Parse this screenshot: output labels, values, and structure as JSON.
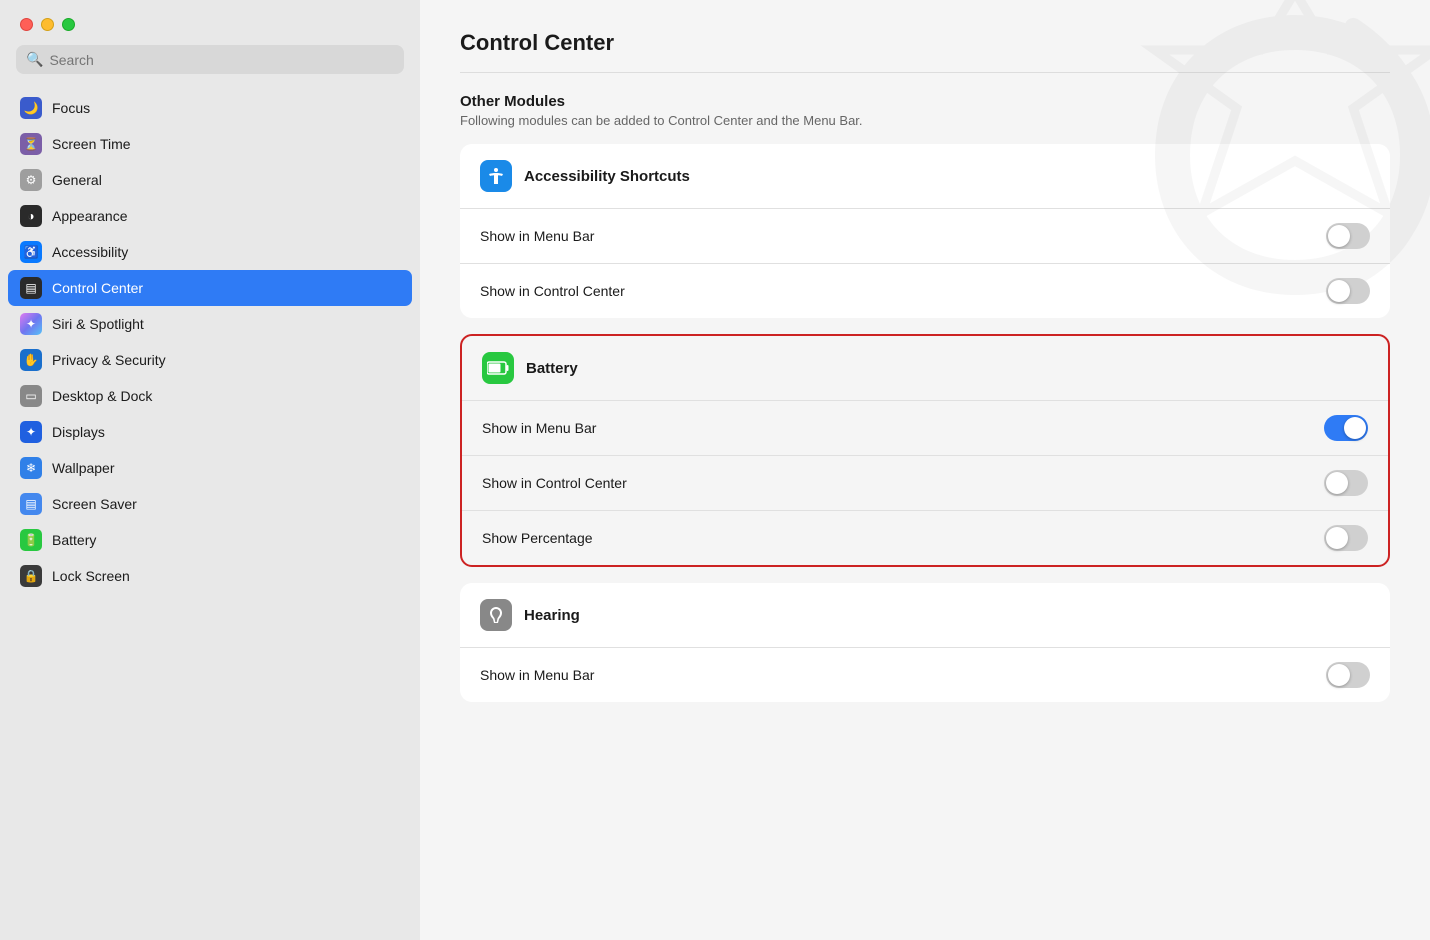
{
  "window": {
    "title": "Control Center"
  },
  "search": {
    "placeholder": "Search"
  },
  "sidebar": {
    "items": [
      {
        "id": "focus",
        "label": "Focus",
        "icon": "focus-blue",
        "emoji": "🌙"
      },
      {
        "id": "screen-time",
        "label": "Screen Time",
        "icon": "screen-time-purple",
        "emoji": "⏳"
      },
      {
        "id": "general",
        "label": "General",
        "icon": "general-gray",
        "emoji": "⚙"
      },
      {
        "id": "appearance",
        "label": "Appearance",
        "icon": "appearance-dark",
        "emoji": "◑"
      },
      {
        "id": "accessibility",
        "label": "Accessibility",
        "icon": "accessibility-blue",
        "emoji": "♿"
      },
      {
        "id": "control-center",
        "label": "Control Center",
        "icon": "control-center-dark",
        "emoji": "▤",
        "active": true
      },
      {
        "id": "siri-spotlight",
        "label": "Siri & Spotlight",
        "icon": "siri-gradient",
        "emoji": "✦"
      },
      {
        "id": "privacy-security",
        "label": "Privacy & Security",
        "icon": "privacy-blue",
        "emoji": "✋"
      },
      {
        "id": "desktop-dock",
        "label": "Desktop & Dock",
        "icon": "desktop-gray",
        "emoji": "▭"
      },
      {
        "id": "displays",
        "label": "Displays",
        "icon": "displays-blue",
        "emoji": "✦"
      },
      {
        "id": "wallpaper",
        "label": "Wallpaper",
        "icon": "wallpaper-blue",
        "emoji": "❄"
      },
      {
        "id": "screen-saver",
        "label": "Screen Saver",
        "icon": "screensaver-blue",
        "emoji": "▤"
      },
      {
        "id": "battery",
        "label": "Battery",
        "icon": "battery-green",
        "emoji": "🔋"
      },
      {
        "id": "lock-screen",
        "label": "Lock Screen",
        "icon": "lockscreen-dark",
        "emoji": "🔒"
      }
    ]
  },
  "main": {
    "title": "Control Center",
    "other_modules": {
      "section_title": "Other Modules",
      "section_subtitle": "Following modules can be added to Control Center and the Menu Bar.",
      "modules": [
        {
          "id": "accessibility-shortcuts",
          "icon_type": "accessibility",
          "title": "Accessibility Shortcuts",
          "rows": [
            {
              "id": "acc-menu-bar",
              "label": "Show in Menu Bar",
              "toggle": "off"
            },
            {
              "id": "acc-control-center",
              "label": "Show in Control Center",
              "toggle": "off"
            }
          ],
          "highlighted": false
        },
        {
          "id": "battery",
          "icon_type": "battery-icon",
          "title": "Battery",
          "rows": [
            {
              "id": "bat-menu-bar",
              "label": "Show in Menu Bar",
              "toggle": "on"
            },
            {
              "id": "bat-control-center",
              "label": "Show in Control Center",
              "toggle": "off"
            },
            {
              "id": "bat-percentage",
              "label": "Show Percentage",
              "toggle": "off"
            }
          ],
          "highlighted": true
        },
        {
          "id": "hearing",
          "icon_type": "hearing-icon",
          "title": "Hearing",
          "rows": [
            {
              "id": "hear-menu-bar",
              "label": "Show in Menu Bar",
              "toggle": "off"
            }
          ],
          "highlighted": false
        }
      ]
    }
  }
}
